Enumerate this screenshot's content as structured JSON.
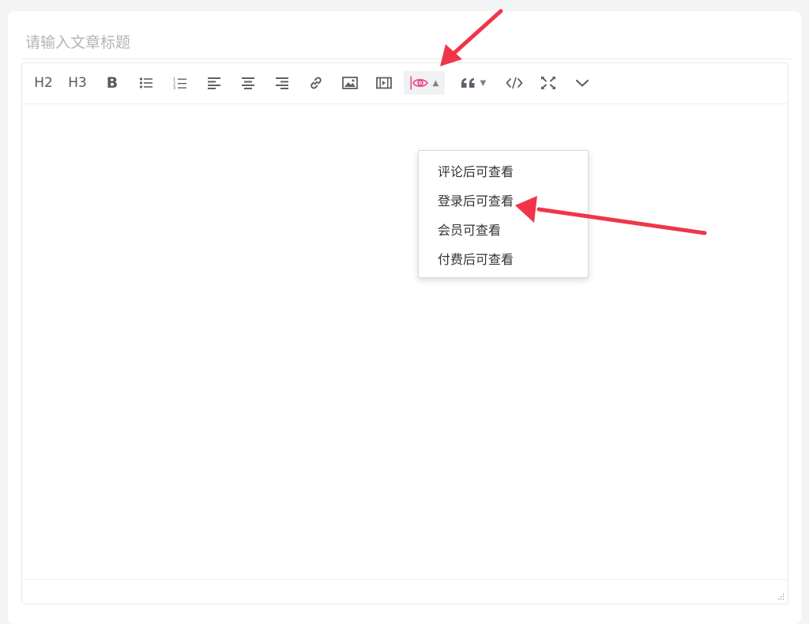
{
  "title_input": {
    "placeholder": "请输入文章标题",
    "value": ""
  },
  "toolbar": {
    "h2_label": "H2",
    "h3_label": "H3",
    "bold_label": "B",
    "icons": [
      "unordered-list-icon",
      "ordered-list-icon",
      "align-left-icon",
      "align-center-icon",
      "align-right-icon",
      "link-icon",
      "image-icon",
      "video-icon",
      "hide-content-icon",
      "quote-icon",
      "code-icon",
      "fullscreen-icon",
      "chevron-down-icon"
    ]
  },
  "dropdown": {
    "items": [
      {
        "label": "评论后可查看"
      },
      {
        "label": "登录后可查看"
      },
      {
        "label": "会员可查看"
      },
      {
        "label": "付费后可查看"
      }
    ]
  },
  "colors": {
    "accent_pink": "#e94a8e",
    "annotation_red": "#f0354a",
    "icon_gray": "#5b6068"
  }
}
